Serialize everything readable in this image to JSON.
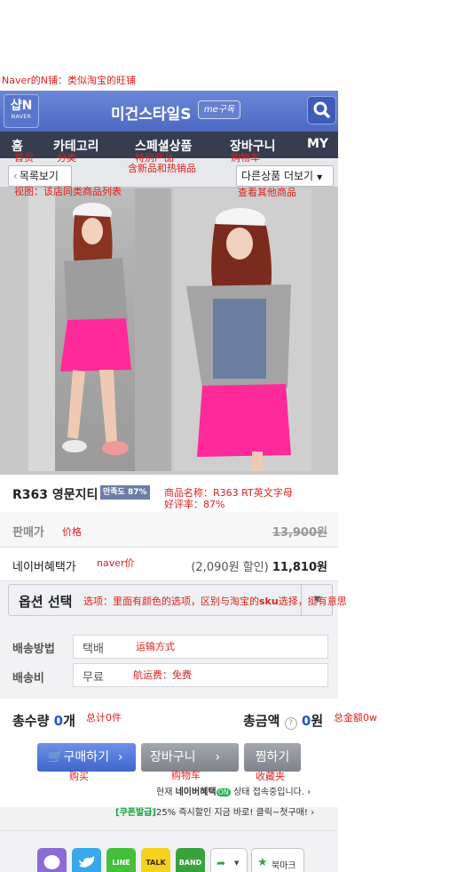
{
  "annotations": {
    "top_note": "Naver的N铺：类似淘宝的旺铺",
    "home": "首页",
    "category": "分类",
    "special_1": "特别产品",
    "special_2": "含新品和热销品",
    "cart_nav": "购物车",
    "list_view": "视图：该店同类商品列表",
    "more_products": "查看其他商品",
    "product_name_1": "商品名称：R363 RT英文字母",
    "product_name_2": "好评率：87%",
    "price": "价格",
    "naver_price": "naver价",
    "option_pre": "选项：里面有颜色的选项，区别与淘宝的",
    "option_sku": "sku",
    "option_post": "选择，挺有意思",
    "ship_method": "运输方式",
    "ship_fee": "航运费：免费",
    "total_qty": "总计0件",
    "total_amount": "总金额0w",
    "buy": "购买",
    "cart": "购物车",
    "wish": "收藏夹"
  },
  "header": {
    "logo_main": "샵N",
    "logo_sub": "NAVER",
    "shop_title": "미건스타일S",
    "subscribe_badge": "me구독"
  },
  "nav": {
    "home": "홈",
    "category": "카테고리",
    "special": "스페셜상품",
    "cart": "장바구니",
    "my": "MY"
  },
  "subbar": {
    "list_button": "목록보기",
    "more_button": "다른상품 더보기"
  },
  "product": {
    "name": "R363 영문지티",
    "satisfaction": "만족도 87%",
    "price_label": "판매가",
    "price_original": "13,900원",
    "benefit_label": "네이버혜택가",
    "benefit_discount": "(2,090원 할인)",
    "benefit_price": "11,810원",
    "option_label": "옵션 선택"
  },
  "shipping": {
    "method_label": "배송방법",
    "method_value": "택배",
    "fee_label": "배송비",
    "fee_value": "무료"
  },
  "totals": {
    "qty_label": "총수량",
    "qty_value": "0",
    "qty_unit": "개",
    "amount_label": "총금액",
    "amount_value": "0",
    "amount_unit": "원"
  },
  "buttons": {
    "buy": "구매하기",
    "cart": "장바구니",
    "wish": "찜하기"
  },
  "promo": {
    "line1_pre": "현재",
    "line1_brand": "네이버혜택",
    "line1_badge": "ON",
    "line1_post": "상태 접속중입니다.",
    "coupon_tag": "[쿠폰발급]",
    "line2": "25% 즉시할인 지금 바로! 클릭~첫구매!"
  },
  "share": {
    "line": "LINE",
    "talk": "TALK",
    "band": "BAND",
    "bookmark": "북마크"
  },
  "colors": {
    "header_blue": "#5472c8",
    "nav_dark": "#363d4f",
    "annotation_red": "#e0201e",
    "buy_button": "#4a73d9",
    "gray_button": "#8c8f96"
  }
}
